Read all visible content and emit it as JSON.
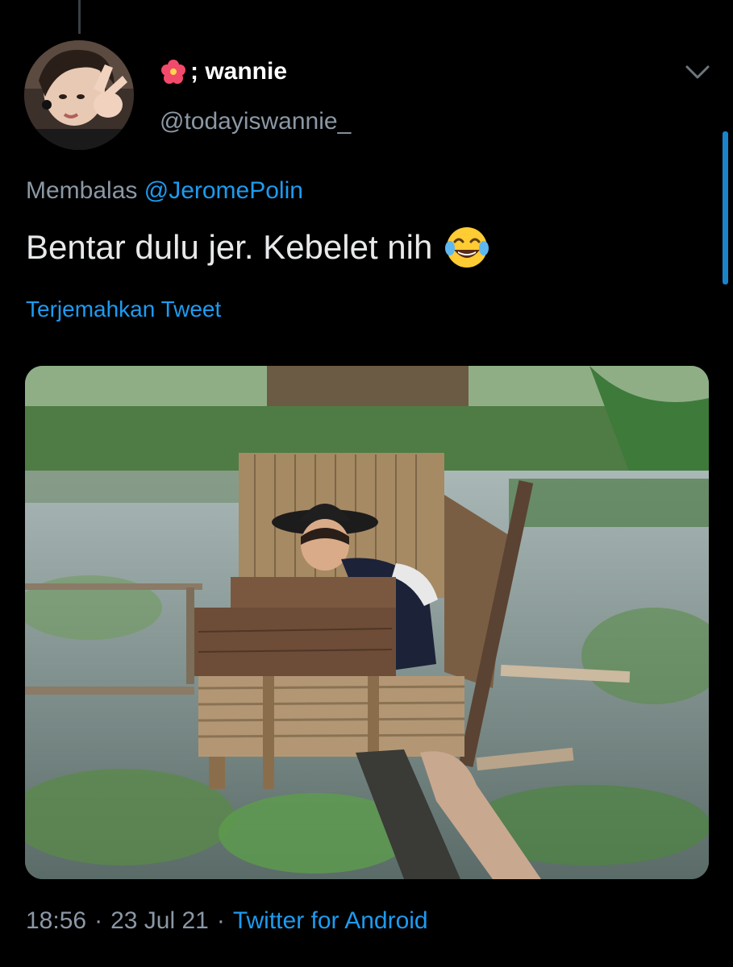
{
  "tweet": {
    "display_name": "; wannie",
    "name_icon": "hibiscus-icon",
    "handle": "@todayiswannie_",
    "reply_prefix": "Membalas",
    "reply_mention": "@JeromePolin",
    "text": "Bentar dulu jer. Kebelet nih",
    "text_emoji": "face-with-tears-of-joy-icon",
    "translate_label": "Terjemahkan Tweet",
    "time": "18:56",
    "separator": "·",
    "date": "23 Jul 21",
    "source": "Twitter for Android"
  },
  "colors": {
    "background": "#000000",
    "link": "#1d9bf0",
    "secondary_text": "#8b98a5",
    "primary_text": "#e7e9ea"
  }
}
